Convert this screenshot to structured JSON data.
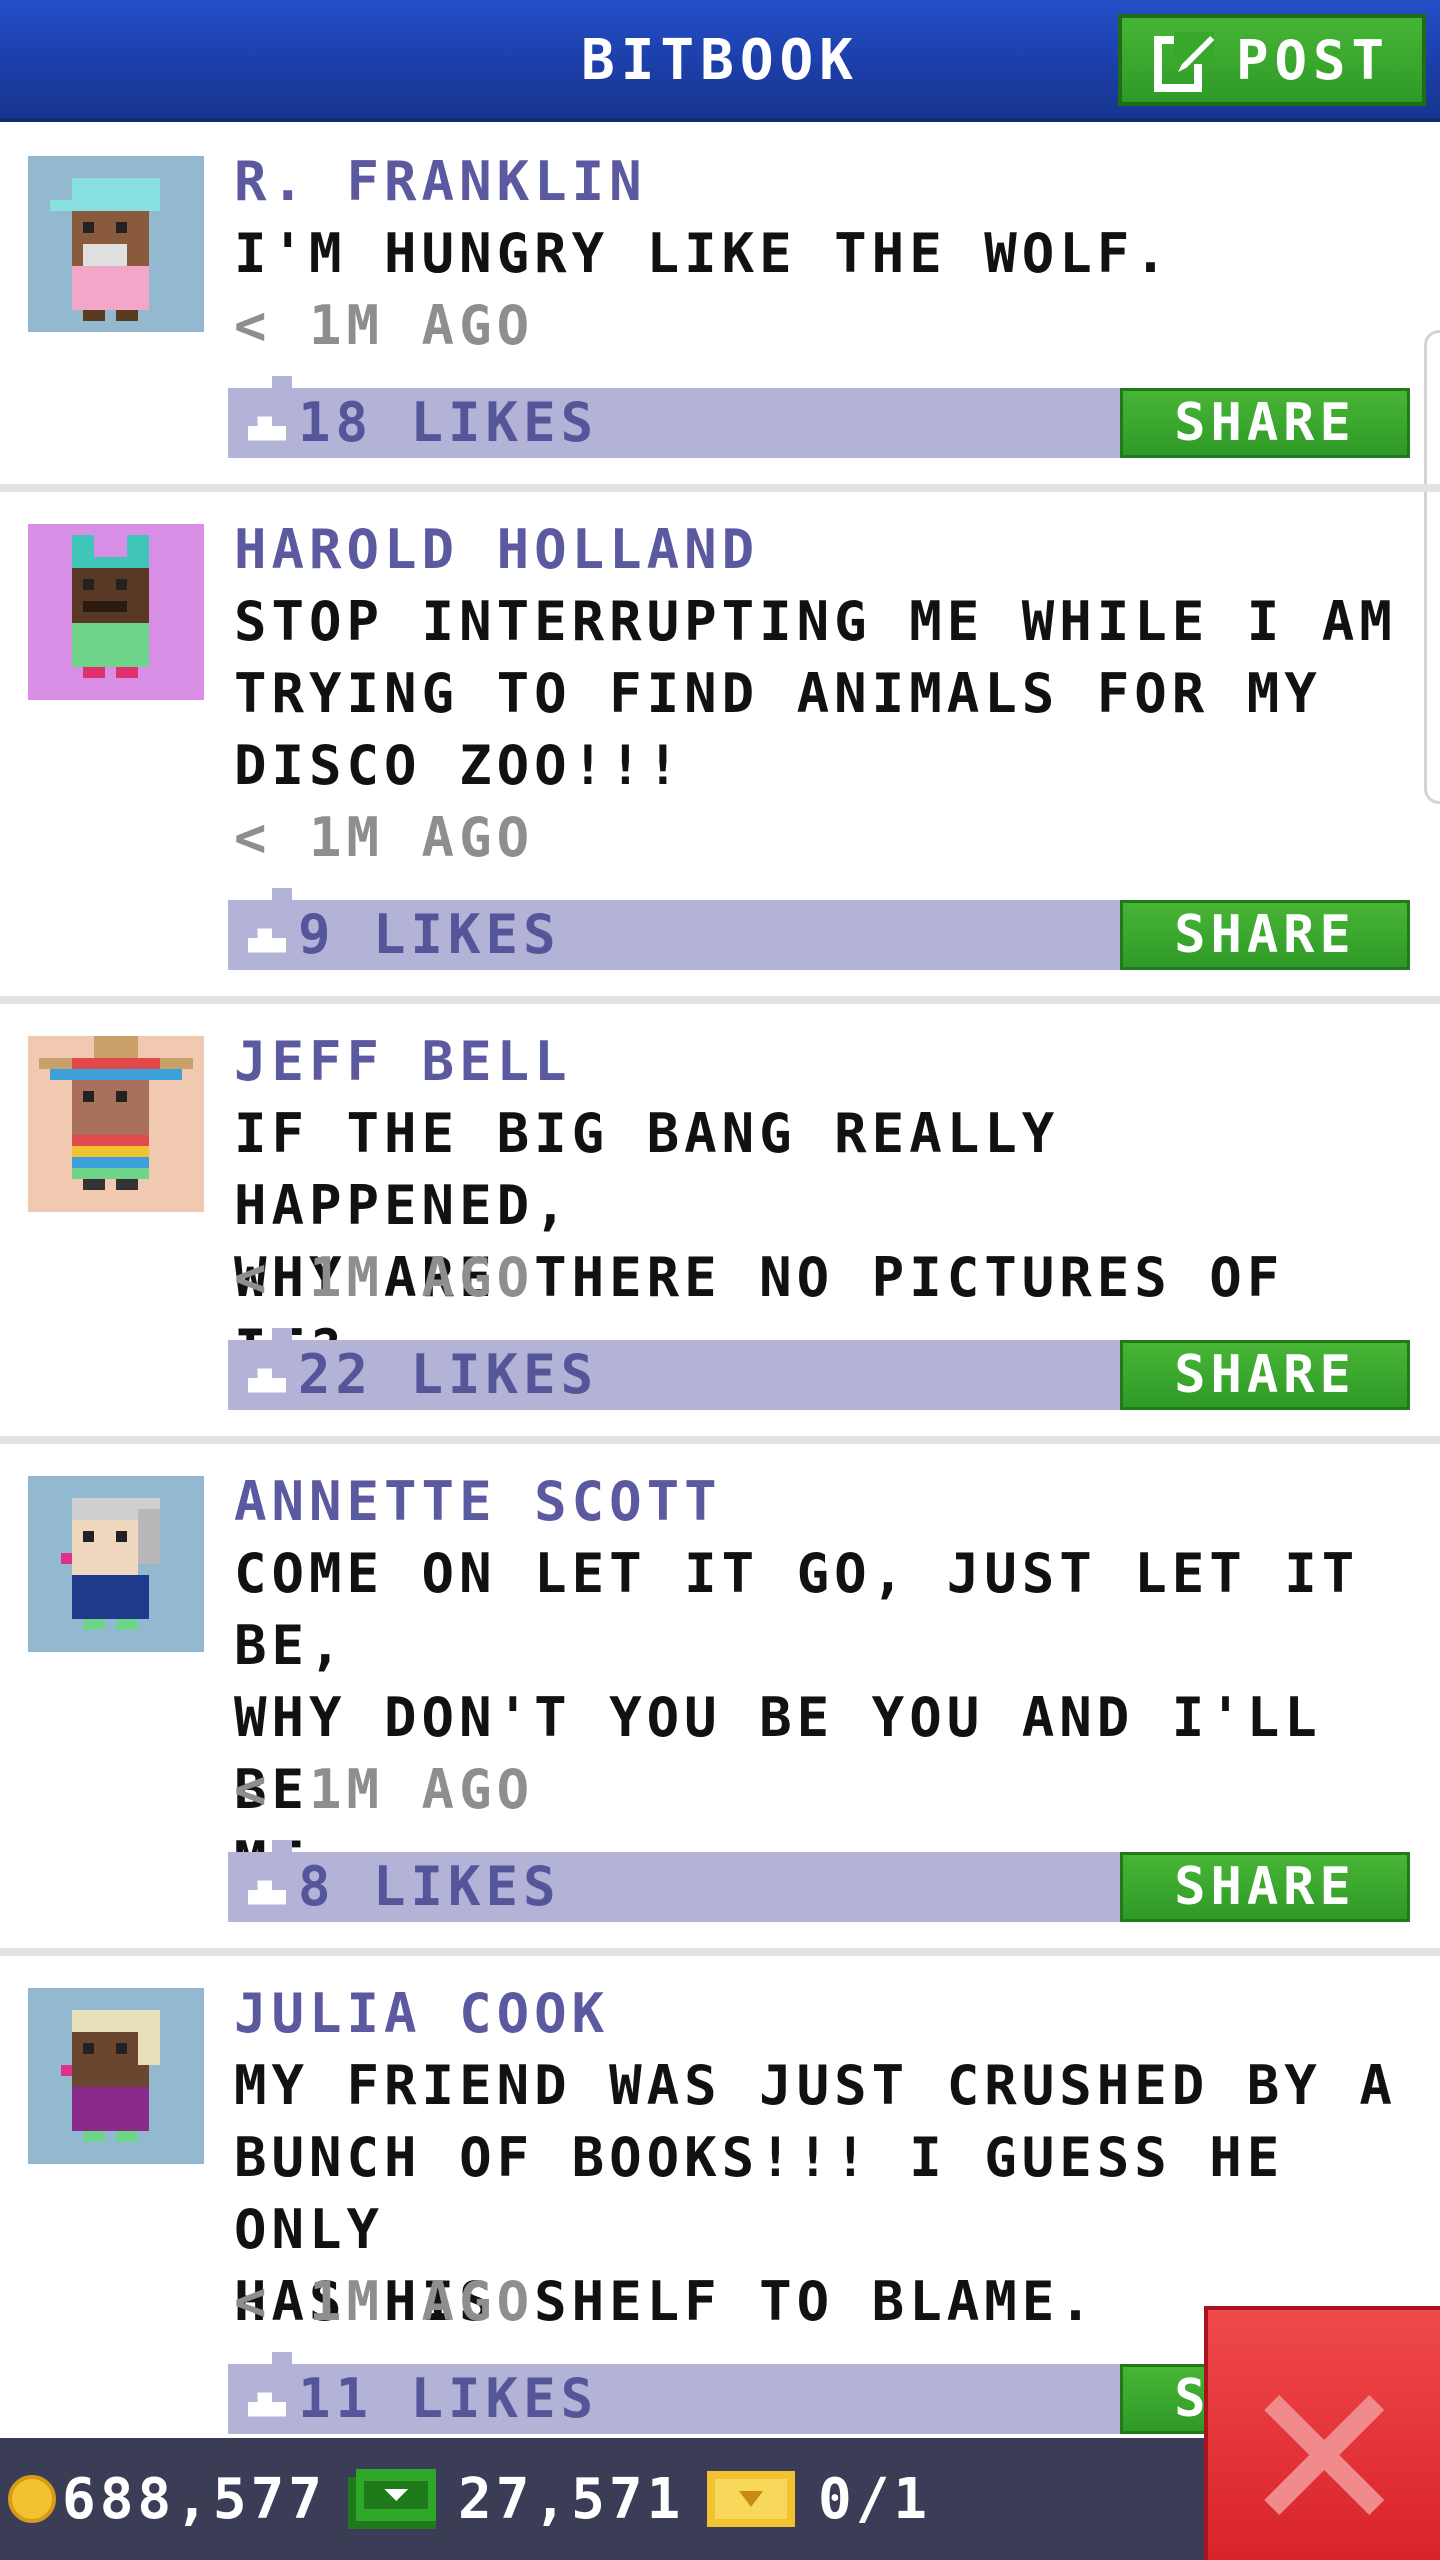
{
  "header": {
    "title": "BITBOOK",
    "post_label": "POST"
  },
  "posts": [
    {
      "name": "R. FRANKLIN",
      "lines": [
        "I'M HUNGRY LIKE THE WOLF."
      ],
      "time": "< 1M AGO",
      "likes": "18 LIKES",
      "share": "SHARE",
      "avatar": "r-franklin-avatar"
    },
    {
      "name": "HAROLD HOLLAND",
      "lines": [
        "STOP INTERRUPTING ME WHILE I AM",
        "TRYING TO FIND ANIMALS FOR MY",
        "DISCO ZOO!!!"
      ],
      "time": "< 1M AGO",
      "likes": "9 LIKES",
      "share": "SHARE",
      "avatar": "harold-holland-avatar"
    },
    {
      "name": "JEFF BELL",
      "lines": [
        "IF THE BIG BANG REALLY HAPPENED,",
        "WHY ARE THERE NO PICTURES OF IT?"
      ],
      "time": "< 1M AGO",
      "likes": "22 LIKES",
      "share": "SHARE",
      "avatar": "jeff-bell-avatar"
    },
    {
      "name": "ANNETTE SCOTT",
      "lines": [
        "COME ON LET IT GO, JUST LET IT BE,",
        "WHY DON'T YOU BE YOU AND I'LL BE",
        "ME."
      ],
      "time": "< 1M AGO",
      "likes": "8 LIKES",
      "share": "SHARE",
      "avatar": "annette-scott-avatar"
    },
    {
      "name": "JULIA COOK",
      "lines": [
        "MY FRIEND WAS JUST CRUSHED BY A",
        "BUNCH OF BOOKS!!! I GUESS HE ONLY",
        "HAS HIS SHELF TO BLAME."
      ],
      "time": "< 1M AGO",
      "likes": "11 LIKES",
      "share": "SHARE",
      "avatar": "julia-cook-avatar"
    }
  ],
  "bottom_bar": {
    "coins": "688,577",
    "bux": "27,571",
    "tickets": "0/1"
  },
  "colors": {
    "header_blue": "#1c3ea8",
    "share_green": "#2e9a26",
    "likes_bar": "#b2b3d6",
    "name_purple": "#5b5aa0",
    "close_red": "#d8232a"
  }
}
